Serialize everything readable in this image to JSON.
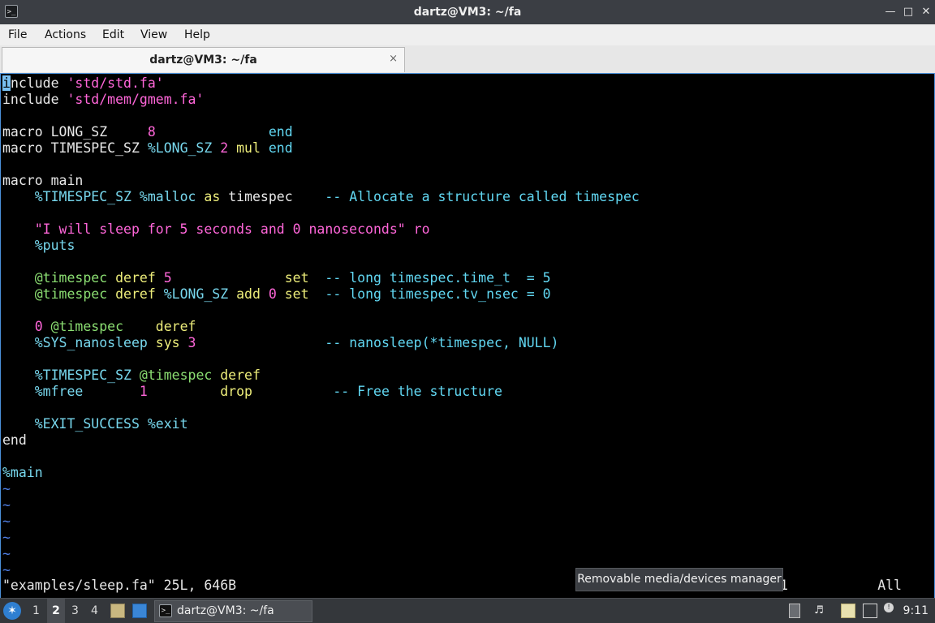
{
  "window": {
    "title": "dartz@VM3: ~/fa",
    "prompt_icon": ">_",
    "minimize_glyph": "—",
    "maximize_glyph": "□",
    "close_glyph": "✕"
  },
  "menu": {
    "file": "File",
    "actions": "Actions",
    "edit": "Edit",
    "view": "View",
    "help": "Help"
  },
  "tab": {
    "label": "dartz@VM3: ~/fa",
    "close_glyph": "×"
  },
  "editor": {
    "lines": [
      [
        {
          "t": "i",
          "c": "cursor"
        },
        {
          "t": "nclude ",
          "c": "kw"
        },
        {
          "t": "'std/std.fa'",
          "c": "str"
        }
      ],
      [
        {
          "t": "include ",
          "c": "kw"
        },
        {
          "t": "'std/mem/gmem.fa'",
          "c": "str"
        }
      ],
      [],
      [
        {
          "t": "macro ",
          "c": "kw"
        },
        {
          "t": "LONG_SZ     ",
          "c": "kw"
        },
        {
          "t": "8",
          "c": "num"
        },
        {
          "t": "              ",
          "c": "kw"
        },
        {
          "t": "end",
          "c": "cyan"
        }
      ],
      [
        {
          "t": "macro ",
          "c": "kw"
        },
        {
          "t": "TIMESPEC_SZ ",
          "c": "kw"
        },
        {
          "t": "%LONG_SZ",
          "c": "mac"
        },
        {
          "t": " ",
          "c": "kw"
        },
        {
          "t": "2",
          "c": "num"
        },
        {
          "t": " ",
          "c": "kw"
        },
        {
          "t": "mul",
          "c": "yel"
        },
        {
          "t": " ",
          "c": "kw"
        },
        {
          "t": "end",
          "c": "cyan"
        }
      ],
      [],
      [
        {
          "t": "macro main",
          "c": "kw"
        }
      ],
      [
        {
          "t": "    ",
          "c": "kw"
        },
        {
          "t": "%TIMESPEC_SZ",
          "c": "mac"
        },
        {
          "t": " ",
          "c": "kw"
        },
        {
          "t": "%malloc",
          "c": "mac"
        },
        {
          "t": " ",
          "c": "kw"
        },
        {
          "t": "as",
          "c": "yel"
        },
        {
          "t": " timespec    ",
          "c": "kw"
        },
        {
          "t": "-- Allocate a structure called timespec",
          "c": "cyan"
        }
      ],
      [],
      [
        {
          "t": "    ",
          "c": "kw"
        },
        {
          "t": "\"I will sleep for 5 seconds and 0 nanoseconds\"",
          "c": "str"
        },
        {
          "t": " ",
          "c": "kw"
        },
        {
          "t": "ro",
          "c": "str"
        }
      ],
      [
        {
          "t": "    ",
          "c": "kw"
        },
        {
          "t": "%puts",
          "c": "mac"
        }
      ],
      [],
      [
        {
          "t": "    ",
          "c": "kw"
        },
        {
          "t": "@timespec",
          "c": "grn"
        },
        {
          "t": " ",
          "c": "kw"
        },
        {
          "t": "deref",
          "c": "yel"
        },
        {
          "t": " ",
          "c": "kw"
        },
        {
          "t": "5",
          "c": "num"
        },
        {
          "t": "              ",
          "c": "kw"
        },
        {
          "t": "set",
          "c": "yel"
        },
        {
          "t": "  ",
          "c": "kw"
        },
        {
          "t": "-- long timespec.time_t  = 5",
          "c": "cyan"
        }
      ],
      [
        {
          "t": "    ",
          "c": "kw"
        },
        {
          "t": "@timespec",
          "c": "grn"
        },
        {
          "t": " ",
          "c": "kw"
        },
        {
          "t": "deref",
          "c": "yel"
        },
        {
          "t": " ",
          "c": "kw"
        },
        {
          "t": "%LONG_SZ",
          "c": "mac"
        },
        {
          "t": " ",
          "c": "kw"
        },
        {
          "t": "add",
          "c": "yel"
        },
        {
          "t": " ",
          "c": "kw"
        },
        {
          "t": "0",
          "c": "num"
        },
        {
          "t": " ",
          "c": "kw"
        },
        {
          "t": "set",
          "c": "yel"
        },
        {
          "t": "  ",
          "c": "kw"
        },
        {
          "t": "-- long timespec.tv_nsec = 0",
          "c": "cyan"
        }
      ],
      [],
      [
        {
          "t": "    ",
          "c": "kw"
        },
        {
          "t": "0",
          "c": "num"
        },
        {
          "t": " ",
          "c": "kw"
        },
        {
          "t": "@timespec",
          "c": "grn"
        },
        {
          "t": "    ",
          "c": "kw"
        },
        {
          "t": "deref",
          "c": "yel"
        }
      ],
      [
        {
          "t": "    ",
          "c": "kw"
        },
        {
          "t": "%SYS_nanosleep",
          "c": "mac"
        },
        {
          "t": " ",
          "c": "kw"
        },
        {
          "t": "sys",
          "c": "yel"
        },
        {
          "t": " ",
          "c": "kw"
        },
        {
          "t": "3",
          "c": "num"
        },
        {
          "t": "                ",
          "c": "kw"
        },
        {
          "t": "-- nanosleep(*timespec, NULL)",
          "c": "cyan"
        }
      ],
      [],
      [
        {
          "t": "    ",
          "c": "kw"
        },
        {
          "t": "%TIMESPEC_SZ",
          "c": "mac"
        },
        {
          "t": " ",
          "c": "kw"
        },
        {
          "t": "@timespec",
          "c": "grn"
        },
        {
          "t": " ",
          "c": "kw"
        },
        {
          "t": "deref",
          "c": "yel"
        }
      ],
      [
        {
          "t": "    ",
          "c": "kw"
        },
        {
          "t": "%mfree",
          "c": "mac"
        },
        {
          "t": "       ",
          "c": "kw"
        },
        {
          "t": "1",
          "c": "num"
        },
        {
          "t": "         ",
          "c": "kw"
        },
        {
          "t": "drop",
          "c": "yel"
        },
        {
          "t": "          ",
          "c": "kw"
        },
        {
          "t": "-- Free the structure",
          "c": "cyan"
        }
      ],
      [],
      [
        {
          "t": "    ",
          "c": "kw"
        },
        {
          "t": "%EXIT_SUCCESS",
          "c": "mac"
        },
        {
          "t": " ",
          "c": "kw"
        },
        {
          "t": "%exit",
          "c": "mac"
        }
      ],
      [
        {
          "t": "end",
          "c": "kw"
        }
      ],
      [],
      [
        {
          "t": "%main",
          "c": "mac"
        }
      ],
      [
        {
          "t": "~",
          "c": "tilde"
        }
      ],
      [
        {
          "t": "~",
          "c": "tilde"
        }
      ],
      [
        {
          "t": "~",
          "c": "tilde"
        }
      ],
      [
        {
          "t": "~",
          "c": "tilde"
        }
      ],
      [
        {
          "t": "~",
          "c": "tilde"
        }
      ],
      [
        {
          "t": "~",
          "c": "tilde"
        }
      ]
    ],
    "status_message": "\"examples/sleep.fa\" 25L, 646B",
    "ruler_partial": "1",
    "ruler_position": "All"
  },
  "tooltip": {
    "text": "Removable media/devices manager"
  },
  "taskbar": {
    "workspaces": [
      "1",
      "2",
      "3",
      "4"
    ],
    "active_workspace": "2",
    "task_label": "dartz@VM3: ~/fa",
    "clock": "9:11",
    "start_glyph": "✶"
  },
  "colors": {
    "accent": "#4a90d9",
    "string": "#ff66d9",
    "keyword_cyan": "#61d7f2",
    "identifier_green": "#8bde72",
    "operator_yellow": "#eded7a",
    "tilde_blue": "#4f7fe6"
  }
}
